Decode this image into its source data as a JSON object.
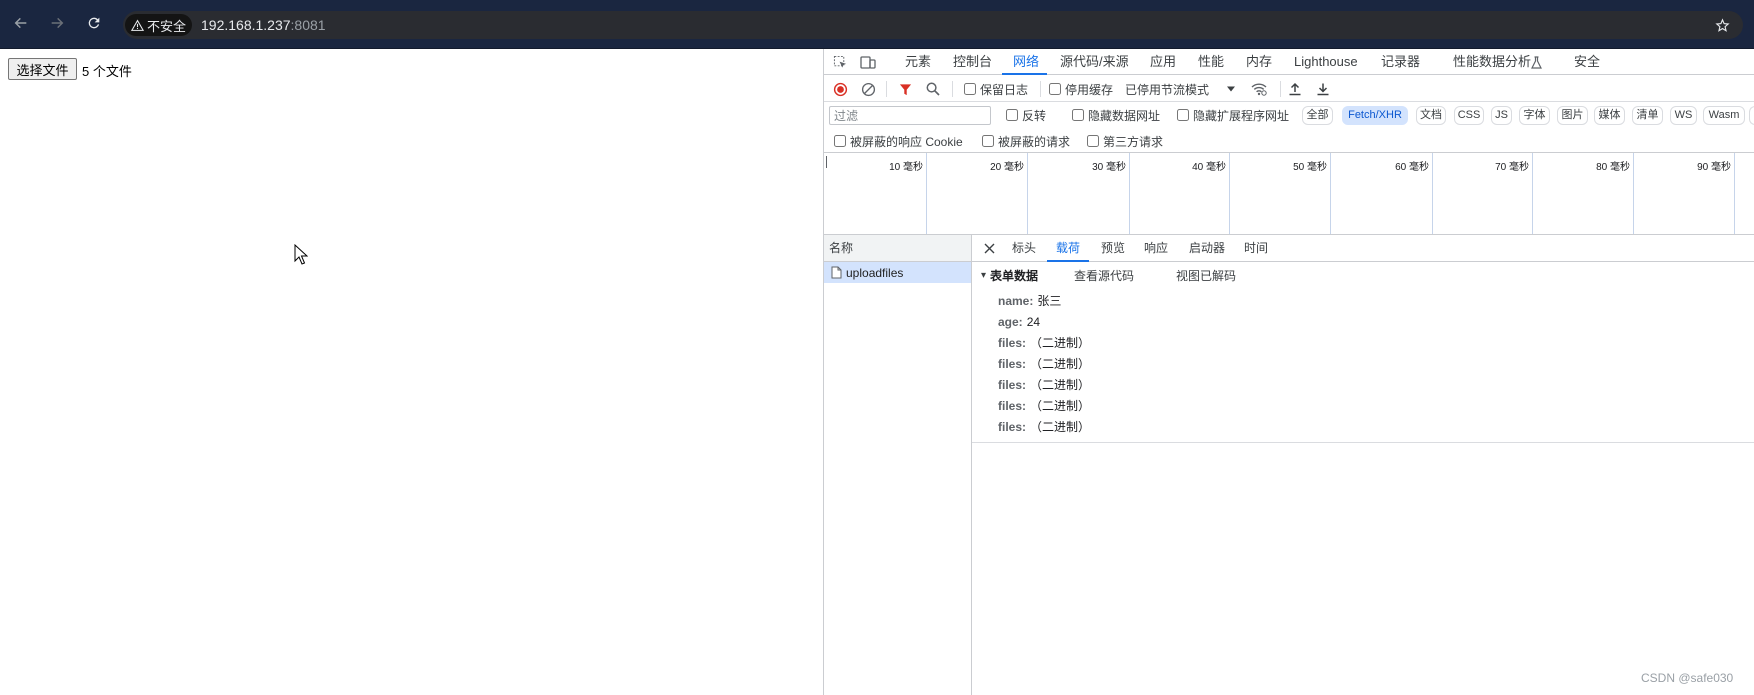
{
  "browser": {
    "security_label": "不安全",
    "url_host": "192.168.1.237",
    "url_port": ":8081",
    "icons": {
      "back": "arrow-left-icon",
      "forward": "arrow-right-icon",
      "reload": "reload-icon",
      "security": "warning-icon",
      "bookmark": "star-icon"
    }
  },
  "page": {
    "file_button_label": "选择文件",
    "file_status": "5 个文件"
  },
  "devtools": {
    "tabs": [
      {
        "label": "元素",
        "active": false
      },
      {
        "label": "控制台",
        "active": false
      },
      {
        "label": "网络",
        "active": true
      },
      {
        "label": "源代码/来源",
        "active": false
      },
      {
        "label": "应用",
        "active": false
      },
      {
        "label": "性能",
        "active": false
      },
      {
        "label": "内存",
        "active": false
      },
      {
        "label": "Lighthouse",
        "active": false
      },
      {
        "label": "记录器",
        "active": false
      },
      {
        "label": "性能数据分析",
        "active": false
      },
      {
        "label": "安全",
        "active": false
      }
    ],
    "toolbar": {
      "preserve_log": {
        "label": "保留日志",
        "checked": false
      },
      "disable_cache": {
        "label": "停用缓存",
        "checked": false
      },
      "throttling": "已停用节流模式"
    },
    "filter": {
      "placeholder": "过滤",
      "invert": {
        "label": "反转",
        "checked": false
      },
      "hide_data_urls": {
        "label": "隐藏数据网址",
        "checked": false
      },
      "hide_extension_urls": {
        "label": "隐藏扩展程序网址",
        "checked": false
      },
      "types": [
        {
          "label": "全部",
          "active": false
        },
        {
          "label": "Fetch/XHR",
          "active": true
        },
        {
          "label": "文档",
          "active": false
        },
        {
          "label": "CSS",
          "active": false
        },
        {
          "label": "JS",
          "active": false
        },
        {
          "label": "字体",
          "active": false
        },
        {
          "label": "图片",
          "active": false
        },
        {
          "label": "媒体",
          "active": false
        },
        {
          "label": "清单",
          "active": false
        },
        {
          "label": "WS",
          "active": false
        },
        {
          "label": "Wasm",
          "active": false
        }
      ],
      "blocked_cookies": {
        "label": "被屏蔽的响应 Cookie",
        "checked": false
      },
      "blocked_requests": {
        "label": "被屏蔽的请求",
        "checked": false
      },
      "third_party": {
        "label": "第三方请求",
        "checked": false
      }
    },
    "timeline": {
      "labels": [
        "10 毫秒",
        "20 毫秒",
        "30 毫秒",
        "40 毫秒",
        "50 毫秒",
        "60 毫秒",
        "70 毫秒",
        "80 毫秒",
        "90 毫秒"
      ]
    },
    "requests": {
      "column_name": "名称",
      "rows": [
        {
          "name": "uploadfiles",
          "selected": true
        }
      ]
    },
    "detail": {
      "tabs": [
        {
          "label": "标头",
          "active": false
        },
        {
          "label": "载荷",
          "active": true
        },
        {
          "label": "预览",
          "active": false
        },
        {
          "label": "响应",
          "active": false
        },
        {
          "label": "启动器",
          "active": false
        },
        {
          "label": "时间",
          "active": false
        }
      ],
      "section_title": "表单数据",
      "view_source": "查看源代码",
      "view_decoded": "视图已解码",
      "fields": [
        {
          "key": "name:",
          "value": "张三"
        },
        {
          "key": "age:",
          "value": "24"
        },
        {
          "key": "files:",
          "value": "（二进制）"
        },
        {
          "key": "files:",
          "value": "（二进制）"
        },
        {
          "key": "files:",
          "value": "（二进制）"
        },
        {
          "key": "files:",
          "value": "（二进制）"
        },
        {
          "key": "files:",
          "value": "（二进制）"
        }
      ]
    }
  },
  "watermark": "CSDN @safe030",
  "colors": {
    "accent": "#1a73e8",
    "record_active": "#d93025",
    "selected_row": "#d3e3fd",
    "chrome_frame": "#1a2640",
    "omnibox": "#2a2c31"
  }
}
